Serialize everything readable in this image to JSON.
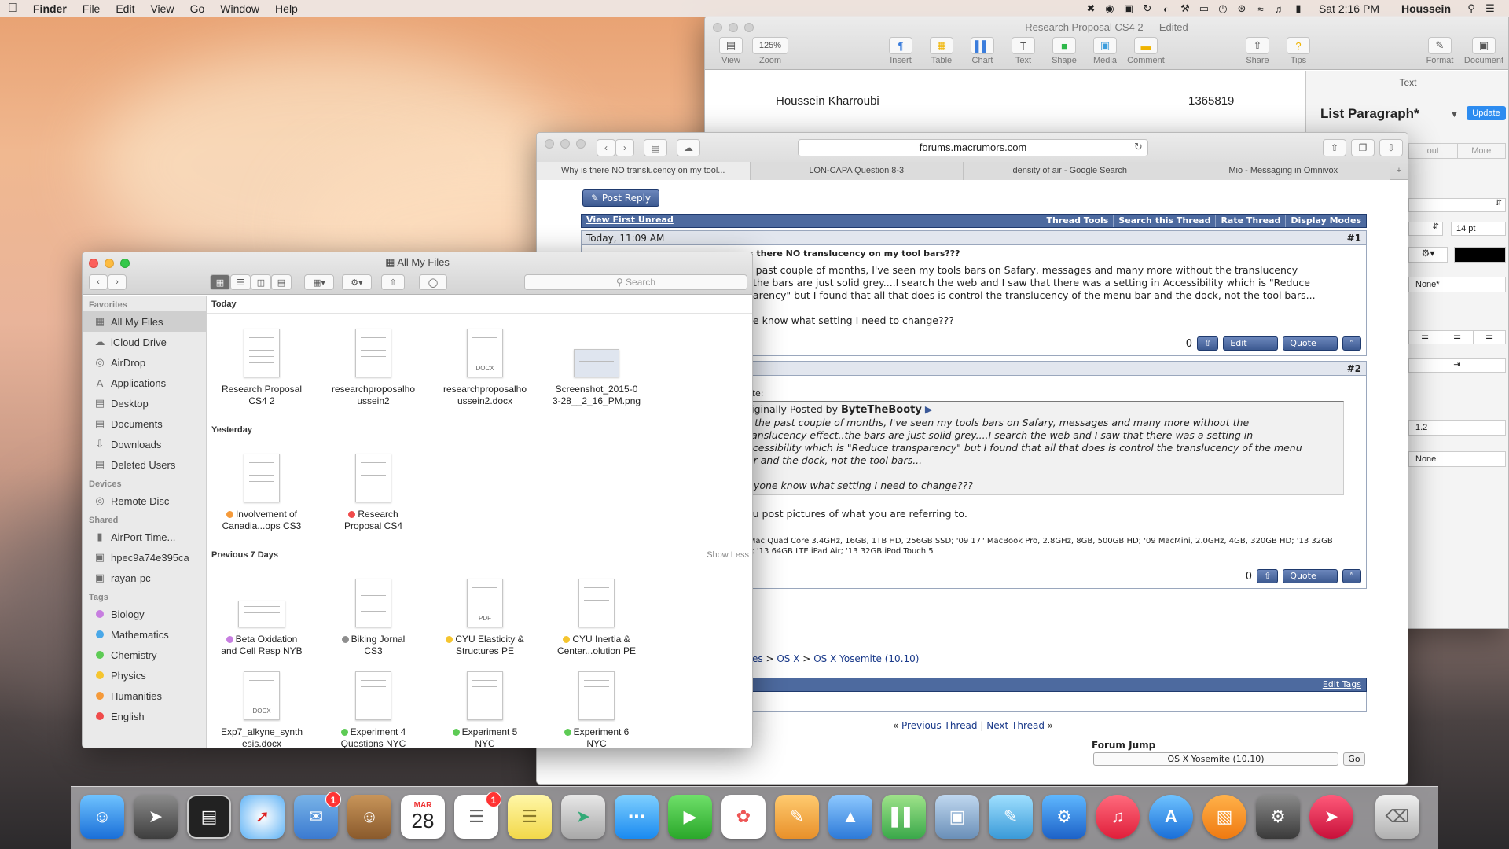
{
  "menubar": {
    "app": "Finder",
    "items": [
      "File",
      "Edit",
      "View",
      "Go",
      "Window",
      "Help"
    ],
    "clock": "Sat 2:16 PM",
    "user": "Houssein"
  },
  "pages": {
    "title": "Research Proposal CS4 2 — Edited",
    "toolbar": {
      "view": "View",
      "zoom_value": "125%",
      "zoom": "Zoom",
      "insert": "Insert",
      "table": "Table",
      "chart": "Chart",
      "text": "Text",
      "shape": "Shape",
      "media": "Media",
      "comment": "Comment",
      "share": "Share",
      "tips": "Tips",
      "format": "Format",
      "document": "Document"
    },
    "doc": {
      "name": "Houssein Kharroubi",
      "number": "1365819"
    },
    "sidebar": {
      "header": "Text",
      "style": "List Paragraph*",
      "update": "Update",
      "tab_layout": "out",
      "tab_more": "More",
      "font_size": "14 pt",
      "list_style": "None*",
      "spacing": "1.2",
      "bullet": "None"
    }
  },
  "safari": {
    "url": "forums.macrumors.com",
    "tabs": [
      "Why is there NO translucency on my tool...",
      "LON-CAPA Question 8-3",
      "density of air - Google Search",
      "Mio - Messaging in Omnivox"
    ],
    "post_reply": "Post Reply",
    "bar": {
      "view_first": "View First Unread",
      "thread_tools": "Thread Tools",
      "search": "Search this Thread",
      "rate": "Rate Thread",
      "display": "Display Modes"
    },
    "post1": {
      "date": "Today, 11:09 AM",
      "num": "#1",
      "title": "s there NO translucency on my tool bars???",
      "line1": "e past couple of months, I've seen my tools bars on Safary, messages and many more without the translucency",
      "line2": "..the bars are just solid grey....I search the web and I saw that there was a setting in Accessibility which is \"Reduce",
      "line3": "parency\" but I found that all that does is control the translucency of the menu bar and the dock, not the tool bars...",
      "line4": "he know what setting I need to change???",
      "count": "0",
      "edit": "Edit",
      "quote": "Quote"
    },
    "post2": {
      "num": "#2",
      "quote_label": "ote:",
      "posted_by": "riginally Posted by",
      "author": "ByteTheBooty",
      "q1": "r the past couple of months, I've seen my tools bars on Safary, messages and many more without the",
      "q2": "ranslucency effect..the bars are just solid grey....I search the web and I saw that there was a setting in",
      "q3": "ccessibility which is \"Reduce transparency\" but I found that all that does is control the translucency of the menu",
      "q4": "ar and the dock, not the tool bars...",
      "q5": "nyone know what setting I need to change???",
      "reply": "ou post pictures of what you are referring to.",
      "sig1": "iMac Quad Core 3.4GHz, 16GB, 1TB HD, 256GB SSD; '09 17\" MacBook Pro, 2.8GHz, 8GB, 500GB HD; '09 MacMini, 2.0GHz, 4GB, 320GB HD; '13 32GB",
      "sig2": "5; '13 64GB LTE iPad Air; '13 32GB iPod Touch 5",
      "count": "0",
      "quote": "Quote"
    },
    "breadcrumb": {
      "a": "nd Services",
      "sep": ">",
      "b": "OS X",
      "c": "OS X Yosemite (10.10)"
    },
    "edit_tags": "Edit Tags",
    "nav": {
      "prev": "Previous Thread",
      "next": "Next Thread",
      "sep": "|",
      "l": "«",
      "r": "»"
    },
    "forum_jump": {
      "label": "Forum Jump",
      "value": "OS X Yosemite (10.10)",
      "go": "Go"
    }
  },
  "finder": {
    "title": "All My Files",
    "search_placeholder": "Search",
    "sidebar": {
      "favorites_label": "Favorites",
      "favorites": [
        "All My Files",
        "iCloud Drive",
        "AirDrop",
        "Applications",
        "Desktop",
        "Documents",
        "Downloads",
        "Deleted Users"
      ],
      "devices_label": "Devices",
      "devices": [
        "Remote Disc"
      ],
      "shared_label": "Shared",
      "shared": [
        "AirPort Time...",
        "hpec9a74e395ca",
        "rayan-pc"
      ],
      "tags_label": "Tags",
      "tags": [
        {
          "name": "Biology",
          "color": "#c77ee0"
        },
        {
          "name": "Mathematics",
          "color": "#4aa8e8"
        },
        {
          "name": "Chemistry",
          "color": "#5ecb55"
        },
        {
          "name": "Physics",
          "color": "#f5c52f"
        },
        {
          "name": "Humanities",
          "color": "#f59a3a"
        },
        {
          "name": "English",
          "color": "#f04b4b"
        }
      ]
    },
    "groups": {
      "today": "Today",
      "yesterday": "Yesterday",
      "prev7": "Previous 7 Days",
      "show_less": "Show Less"
    },
    "files": {
      "f1a": "Research Proposal",
      "f1b": "CS4 2",
      "f2a": "researchproposalho",
      "f2b": "ussein2",
      "f3a": "researchproposalho",
      "f3b": "ussein2.docx",
      "f4a": "Screenshot_2015-0",
      "f4b": "3-28__2_16_PM.png",
      "f5a": "Involvement of",
      "f5b": "Canadia...ops CS3",
      "f6a": "Research",
      "f6b": "Proposal CS4",
      "f7a": "Beta Oxidation",
      "f7b": "and Cell Resp NYB",
      "f8a": "Biking Jornal",
      "f8b": "CS3",
      "f9a": "CYU Elasticity &",
      "f9b": "Structures PE",
      "f10a": "CYU Inertia &",
      "f10b": "Center...olution PE",
      "f11a": "Exp7_alkyne_synth",
      "f11b": "esis.docx",
      "f12a": "Experiment 4",
      "f12b": "Questions NYC",
      "f13a": "Experiment 5",
      "f13b": "NYC",
      "f14a": "Experiment 6",
      "f14b": "NYC",
      "docx": "DOCX",
      "pdf": "PDF"
    }
  },
  "dock": {
    "calendar_month": "MAR",
    "calendar_day": "28",
    "badge_mail": "1",
    "badge_reminders": "1"
  }
}
